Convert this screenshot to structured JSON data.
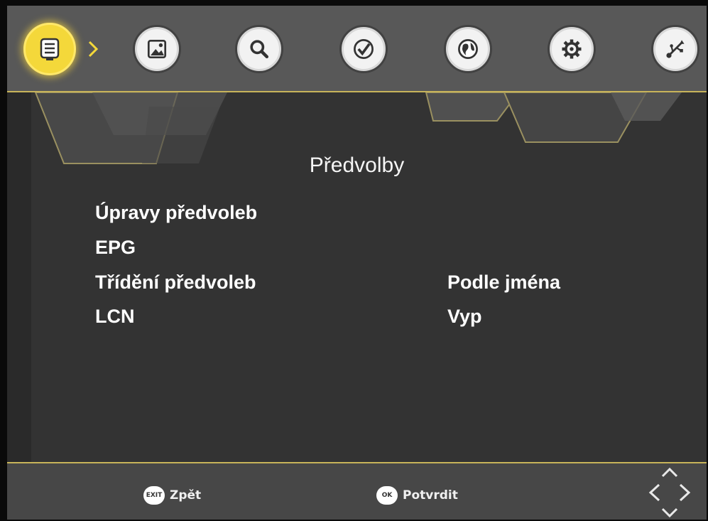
{
  "header": {
    "menu_icons": [
      {
        "name": "channel-list-icon",
        "active": true
      },
      {
        "name": "picture-icon",
        "active": false
      },
      {
        "name": "search-icon",
        "active": false
      },
      {
        "name": "clock-icon",
        "active": false
      },
      {
        "name": "globe-icon",
        "active": false
      },
      {
        "name": "gear-icon",
        "active": false
      },
      {
        "name": "usb-icon",
        "active": false
      }
    ]
  },
  "main": {
    "title": "Předvolby",
    "rows": [
      {
        "label": "Úpravy předvoleb",
        "value": ""
      },
      {
        "label": "EPG",
        "value": ""
      },
      {
        "label": "Třídění předvoleb",
        "value": "Podle jména"
      },
      {
        "label": "LCN",
        "value": "Vyp"
      }
    ]
  },
  "footer": {
    "exit_key": "EXIT",
    "back_label": "Zpět",
    "ok_key": "OK",
    "confirm_label": "Potvrdit"
  },
  "colors": {
    "accent": "#c8b45a",
    "active_icon": "#f4d83a",
    "background": "#333333"
  }
}
